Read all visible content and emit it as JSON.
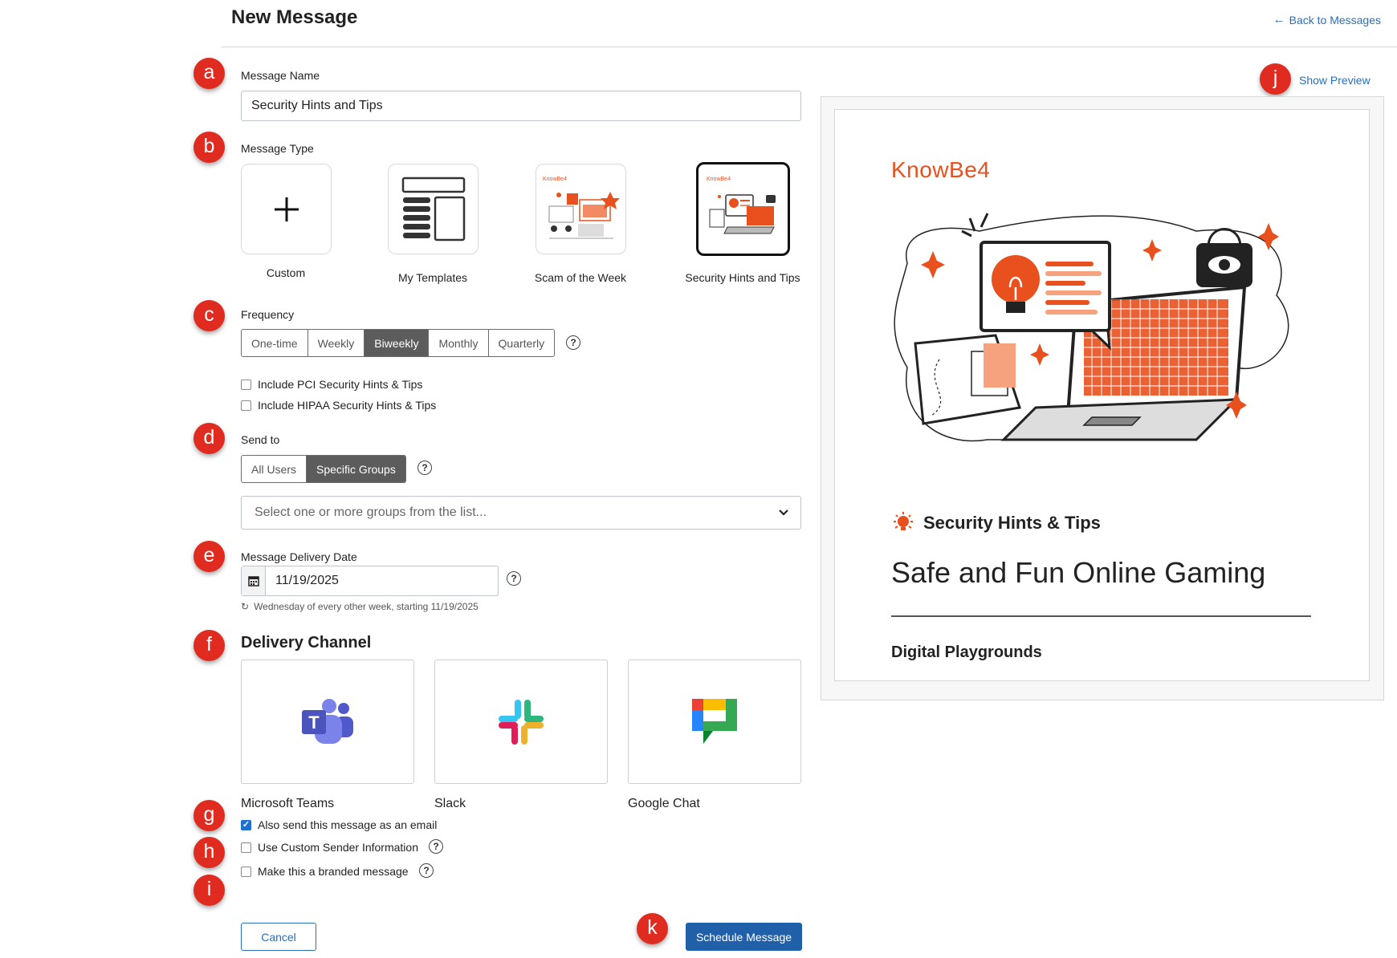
{
  "header": {
    "title": "New Message",
    "back_link": "Back to Messages"
  },
  "markers": [
    "a",
    "b",
    "c",
    "d",
    "e",
    "f",
    "g",
    "h",
    "i",
    "j",
    "k"
  ],
  "message_name": {
    "label": "Message Name",
    "value": "Security Hints and Tips"
  },
  "message_type": {
    "label": "Message Type",
    "options": [
      {
        "label": "Custom",
        "icon": "plus-icon",
        "selected": false
      },
      {
        "label": "My Templates",
        "icon": "template-layout-icon",
        "selected": false
      },
      {
        "label": "Scam of the Week",
        "icon": "scam-of-the-week-thumbnail",
        "selected": false
      },
      {
        "label": "Security Hints and Tips",
        "icon": "security-hints-thumbnail",
        "selected": true
      }
    ]
  },
  "frequency": {
    "label": "Frequency",
    "options": [
      "One-time",
      "Weekly",
      "Biweekly",
      "Monthly",
      "Quarterly"
    ],
    "selected": "Biweekly",
    "include_pci": "Include PCI Security Hints & Tips",
    "include_hipaa": "Include HIPAA Security Hints & Tips"
  },
  "send_to": {
    "label": "Send to",
    "options": [
      "All Users",
      "Specific Groups"
    ],
    "selected": "Specific Groups",
    "groups_placeholder": "Select one or more groups from the list..."
  },
  "delivery_date": {
    "label": "Message Delivery Date",
    "value": "11/19/2025",
    "recurrence": "Wednesday of every other week, starting 11/19/2025"
  },
  "delivery_channel": {
    "title": "Delivery Channel",
    "channels": [
      {
        "label": "Microsoft Teams",
        "icon": "microsoft-teams-icon"
      },
      {
        "label": "Slack",
        "icon": "slack-icon"
      },
      {
        "label": "Google Chat",
        "icon": "google-chat-icon"
      }
    ]
  },
  "options": {
    "also_email": {
      "label": "Also send this message as an email",
      "checked": true
    },
    "custom_sender": {
      "label": "Use Custom Sender Information",
      "checked": false
    },
    "branded": {
      "label": "Make this a branded message",
      "checked": false
    }
  },
  "buttons": {
    "cancel": "Cancel",
    "schedule": "Schedule Message"
  },
  "preview": {
    "toggle_label": "Show Preview",
    "logo": "KnowBe4",
    "tag": "Security Hints & Tips",
    "title": "Safe and Fun Online Gaming",
    "subtitle": "Digital Playgrounds"
  },
  "colors": {
    "accent_blue": "#2060a8",
    "link_blue": "#2a6ebb",
    "marker_red": "#e02b20",
    "brand_orange": "#e8501e",
    "segment_active": "#5c5c5c"
  }
}
